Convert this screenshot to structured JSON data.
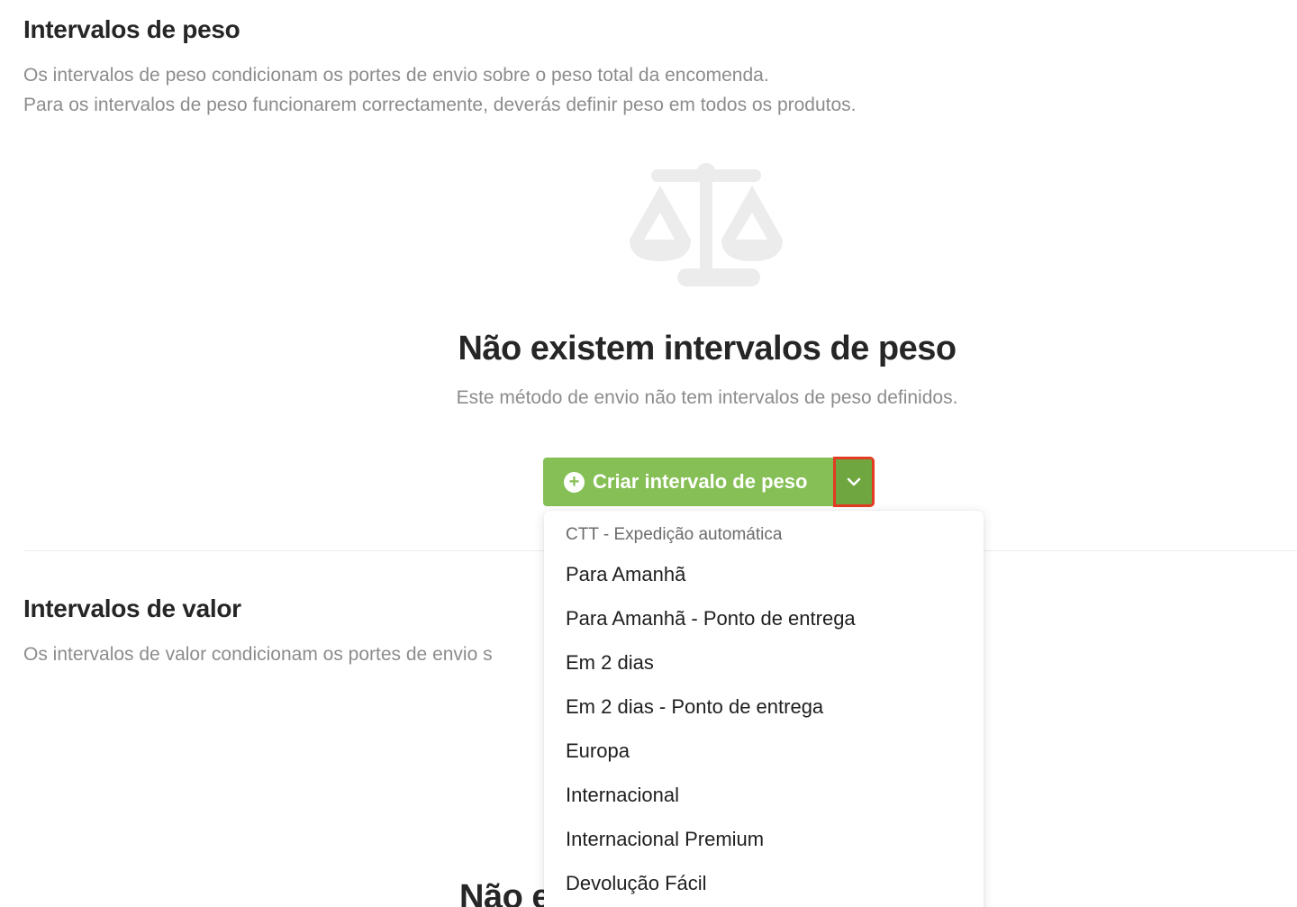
{
  "weight_section": {
    "title": "Intervalos de peso",
    "desc_line1": "Os intervalos de peso condicionam os portes de envio sobre o peso total da encomenda.",
    "desc_line2": "Para os intervalos de peso funcionarem correctamente, deverás definir peso em todos os produtos.",
    "empty_icon": "scale-icon",
    "empty_title": "Não existem intervalos de peso",
    "empty_desc": "Este método de envio não tem intervalos de peso definidos.",
    "create_button_label": "Criar intervalo de peso",
    "create_button_icon": "plus-circle-icon",
    "toggle_icon": "chevron-down-icon"
  },
  "value_section": {
    "title": "Intervalos de valor",
    "desc_line1": "Os intervalos de valor condicionam os portes de envio s",
    "empty_title_partial": "Não e"
  },
  "dropdown": {
    "group_label": "CTT - Expedição automática",
    "items": [
      "Para Amanhã",
      "Para Amanhã - Ponto de entrega",
      "Em 2 dias",
      "Em 2 dias - Ponto de entrega",
      "Europa",
      "Internacional",
      "Internacional Premium",
      "Devolução Fácil"
    ]
  },
  "colors": {
    "primary_green": "#86bf55",
    "toggle_green": "#6fa63f",
    "highlight_red": "#e33b24",
    "muted_text": "#8c8c8c",
    "icon_gray": "#ececec"
  }
}
